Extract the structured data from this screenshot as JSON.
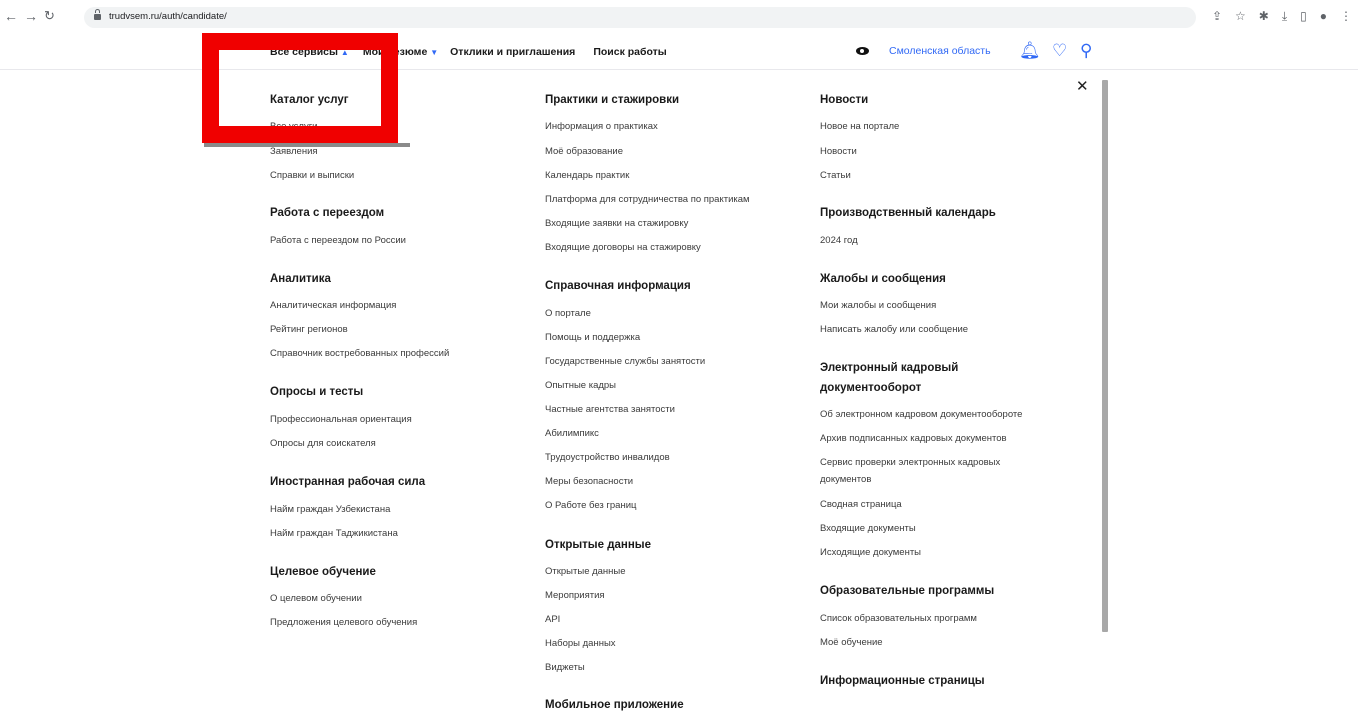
{
  "browser": {
    "url": "trudvsem.ru/auth/candidate/",
    "back_icon": "arrow-left-icon",
    "forward_icon": "arrow-right-icon",
    "reload_icon": "reload-icon"
  },
  "header": {
    "nav": [
      "Все сервисы",
      "Мои резюме",
      "Отклики и приглашения",
      "Поиск работы"
    ],
    "region": "Смоленская область",
    "accent_color": "#3169f5"
  },
  "menu": {
    "col1": {
      "sections": [
        {
          "title": "Каталог услуг",
          "links": [
            "Все услуги",
            "Заявления",
            "Справки и выписки"
          ]
        },
        {
          "title": "Работа с переездом",
          "links": [
            "Работа с переездом по России"
          ]
        },
        {
          "title": "Аналитика",
          "links": [
            "Аналитическая информация",
            "Рейтинг регионов",
            "Справочник востребованных профессий"
          ]
        },
        {
          "title": "Опросы и тесты",
          "links": [
            "Профессиональная ориентация",
            "Опросы для соискателя"
          ]
        },
        {
          "title": "Иностранная рабочая сила",
          "links": [
            "Найм граждан Узбекистана",
            "Найм граждан Таджикистана"
          ]
        },
        {
          "title": "Целевое обучение",
          "links": [
            "О целевом обучении",
            "Предложения целевого обучения"
          ]
        }
      ]
    },
    "col2": {
      "sections": [
        {
          "title": "Практики и стажировки",
          "links": [
            "Информация о практиках",
            "Моё образование",
            "Календарь практик",
            "Платформа для сотрудничества по практикам",
            "Входящие заявки на стажировку",
            "Входящие договоры на стажировку"
          ]
        },
        {
          "title": "Справочная информация",
          "links": [
            "О портале",
            "Помощь и поддержка",
            "Государственные службы занятости",
            "Опытные кадры",
            "Частные агентства занятости",
            "Абилимпикс",
            "Трудоустройство инвалидов",
            "Меры безопасности",
            "О Работе без границ"
          ]
        },
        {
          "title": "Открытые данные",
          "links": [
            "Открытые данные",
            "Мероприятия",
            "API",
            "Наборы данных",
            "Виджеты"
          ]
        },
        {
          "title": "Мобильное приложение",
          "links": []
        }
      ]
    },
    "col3": {
      "sections": [
        {
          "title": "Новости",
          "links": [
            "Новое на портале",
            "Новости",
            "Статьи"
          ]
        },
        {
          "title": "Производственный календарь",
          "links": [
            "2024 год"
          ]
        },
        {
          "title": "Жалобы и сообщения",
          "links": [
            "Мои жалобы и сообщения",
            "Написать жалобу или сообщение"
          ]
        },
        {
          "title_lines": [
            "Электронный кадровый",
            "документооборот"
          ],
          "links": [
            "Об электронном кадровом документообороте",
            "Архив подписанных кадровых документов"
          ],
          "wrapped_link_lines": [
            "Сервис проверки электронных кадровых",
            "документов"
          ],
          "links_after": [
            "Сводная страница",
            "Входящие документы",
            "Исходящие документы"
          ]
        },
        {
          "title": "Образовательные программы",
          "links": [
            "Список образовательных программ",
            "Моё обучение"
          ]
        },
        {
          "title": "Информационные страницы",
          "links": []
        }
      ]
    }
  },
  "highlight_color": "#f00000"
}
